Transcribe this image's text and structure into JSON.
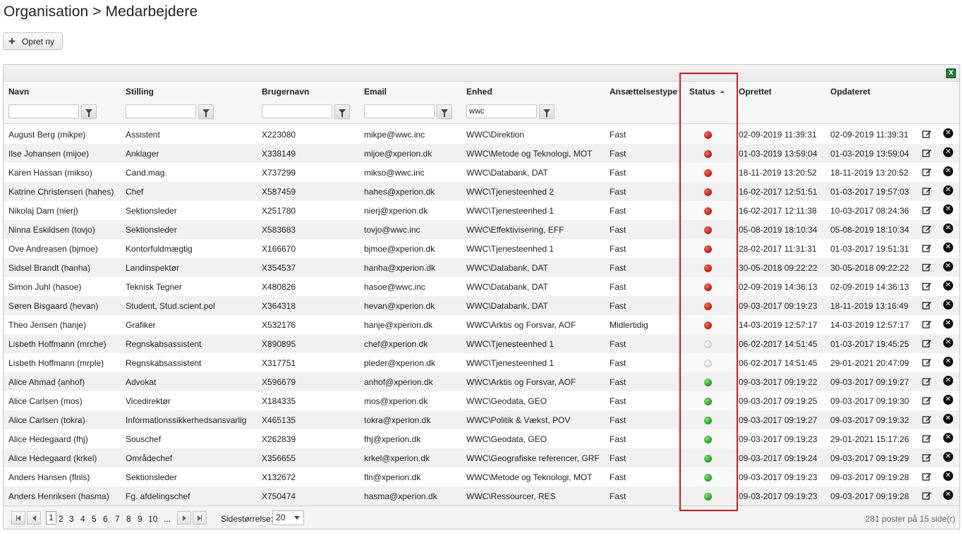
{
  "page": {
    "title": "Organisation > Medarbejdere"
  },
  "toolbar": {
    "create_label": "Opret ny",
    "create_icon": "plus-icon",
    "excel_icon": "excel-export-icon",
    "excel_text": "X"
  },
  "columns": {
    "name": "Navn",
    "position": "Stilling",
    "username": "Brugernavn",
    "email": "Email",
    "unit": "Enhed",
    "employment_type": "Ansættelsestype",
    "status": "Status",
    "created": "Oprettet",
    "updated": "Opdateret"
  },
  "filters": {
    "name": "",
    "position": "",
    "username": "",
    "email": "",
    "unit": "wwc"
  },
  "status_colors": {
    "active": "#1f9b1a",
    "inactive": "#c3170b",
    "unknown": "#d6d6d6"
  },
  "rows": [
    {
      "name": "August Berg (mikpe)",
      "position": "Assistent",
      "username": "X223080",
      "email": "mikpe@wwc.inc",
      "unit": "WWC\\Direktion",
      "type": "Fast",
      "status": "red",
      "created": "02-09-2019 11:39:31",
      "updated": "02-09-2019 11:39:31"
    },
    {
      "name": "Ilse Johansen (mijoe)",
      "position": "Anklager",
      "username": "X338149",
      "email": "mijoe@xperion.dk",
      "unit": "WWC\\Metode og Teknologi, MOT",
      "type": "Fast",
      "status": "red",
      "created": "01-03-2019 13:59:04",
      "updated": "01-03-2019 13:59:04"
    },
    {
      "name": "Karen Hassan (mikso)",
      "position": "Cand.mag.",
      "username": "X737299",
      "email": "mikso@wwc.inc",
      "unit": "WWC\\Databank, DAT",
      "type": "Fast",
      "status": "red",
      "created": "18-11-2019 13:20:52",
      "updated": "18-11-2019 13:20:52"
    },
    {
      "name": "Katrine Christensen (hahes)",
      "position": "Chef",
      "username": "X587459",
      "email": "hahes@xperion.dk",
      "unit": "WWC\\Tjenesteenhed 2",
      "type": "Fast",
      "status": "red",
      "created": "16-02-2017 12:51:51",
      "updated": "01-03-2017 19:57:03"
    },
    {
      "name": "Nikolaj Dam (nierj)",
      "position": "Sektionsleder",
      "username": "X251780",
      "email": "nierj@xperion.dk",
      "unit": "WWC\\Tjenesteenhed 1",
      "type": "Fast",
      "status": "red",
      "created": "16-02-2017 12:11:38",
      "updated": "10-03-2017 08:24:36"
    },
    {
      "name": "Ninna Eskildsen (tovjo)",
      "position": "Sektionsleder",
      "username": "X583683",
      "email": "tovjo@wwc.inc",
      "unit": "WWC\\Effektivisering, EFF",
      "type": "Fast",
      "status": "red",
      "created": "05-08-2019 18:10:34",
      "updated": "05-08-2019 18:10:34"
    },
    {
      "name": "Ove Andreasen (bjmoe)",
      "position": "Kontorfuldmægtig",
      "username": "X166670",
      "email": "bjmoe@xperion.dk",
      "unit": "WWC\\Tjenesteenhed 1",
      "type": "Fast",
      "status": "red",
      "created": "28-02-2017 11:31:31",
      "updated": "01-03-2017 19:51:31"
    },
    {
      "name": "Sidsel Brandt (hanha)",
      "position": "Landinspektør",
      "username": "X354537",
      "email": "hanha@xperion.dk",
      "unit": "WWC\\Databank, DAT",
      "type": "Fast",
      "status": "red",
      "created": "30-05-2018 09:22:22",
      "updated": "30-05-2018 09:22:22"
    },
    {
      "name": "Simon Juhl (hasoe)",
      "position": "Teknisk Tegner",
      "username": "X480826",
      "email": "hasoe@wwc.inc",
      "unit": "WWC\\Databank, DAT",
      "type": "Fast",
      "status": "red",
      "created": "02-09-2019 14:36:13",
      "updated": "02-09-2019 14:36:13"
    },
    {
      "name": "Søren Bisgaard (hevan)",
      "position": "Student, Stud.scient.pol",
      "username": "X364318",
      "email": "hevan@xperion.dk",
      "unit": "WWC\\Databank, DAT",
      "type": "Fast",
      "status": "red",
      "created": "09-03-2017 09:19:23",
      "updated": "18-11-2019 13:16:49"
    },
    {
      "name": "Theo Jensen (hanje)",
      "position": "Grafiker",
      "username": "X532176",
      "email": "hanje@xperion.dk",
      "unit": "WWC\\Arktis og Forsvar, AOF",
      "type": "Midlertidig",
      "status": "red",
      "created": "14-03-2019 12:57:17",
      "updated": "14-03-2019 12:57:17"
    },
    {
      "name": "Lisbeth Hoffmann (mrche)",
      "position": "Regnskabsassistent",
      "username": "X890895",
      "email": "chef@xperion.dk",
      "unit": "WWC\\Tjenesteenhed 1",
      "type": "Fast",
      "status": "grey",
      "created": "06-02-2017 14:51:45",
      "updated": "01-03-2017 19:45:25"
    },
    {
      "name": "Lisbeth Hoffmann (mrple)",
      "position": "Regnskabsassistent",
      "username": "X317751",
      "email": "pleder@xperion.dk",
      "unit": "WWC\\Tjenesteenhed 1",
      "type": "Fast",
      "status": "grey",
      "created": "06-02-2017 14:51:45",
      "updated": "29-01-2021 20:47:09"
    },
    {
      "name": "Alice Ahmad (anhof)",
      "position": "Advokat",
      "username": "X596679",
      "email": "anhof@xperion.dk",
      "unit": "WWC\\Arktis og Forsvar, AOF",
      "type": "Fast",
      "status": "green",
      "created": "09-03-2017 09:19:22",
      "updated": "09-03-2017 09:19:27"
    },
    {
      "name": "Alice Carlsen (mos)",
      "position": "Vicedirektør",
      "username": "X184335",
      "email": "mos@xperion.dk",
      "unit": "WWC\\Geodata, GEO",
      "type": "Fast",
      "status": "green",
      "created": "09-03-2017 09:19:25",
      "updated": "09-03-2017 09:19:30"
    },
    {
      "name": "Alice Carlsen (tokra)",
      "position": "Informationssikkerhedsansvarlig",
      "username": "X465135",
      "email": "tokra@xperion.dk",
      "unit": "WWC\\Politik & Vækst, POV",
      "type": "Fast",
      "status": "green",
      "created": "09-03-2017 09:19:27",
      "updated": "09-03-2017 09:19:32"
    },
    {
      "name": "Alice Hedegaard (fhj)",
      "position": "Souschef",
      "username": "X262839",
      "email": "fhj@xperion.dk",
      "unit": "WWC\\Geodata, GEO",
      "type": "Fast",
      "status": "green",
      "created": "09-03-2017 09:19:23",
      "updated": "29-01-2021 15:17:26"
    },
    {
      "name": "Alice Hedegaard (krkel)",
      "position": "Områdechef",
      "username": "X356655",
      "email": "krkel@xperion.dk",
      "unit": "WWC\\Geografiske referencer, GRF",
      "type": "Fast",
      "status": "green",
      "created": "09-03-2017 09:19:24",
      "updated": "09-03-2017 09:19:29"
    },
    {
      "name": "Anders Hansen (flnis)",
      "position": "Sektionsleder",
      "username": "X132672",
      "email": "fln@xperion.dk",
      "unit": "WWC\\Metode og Teknologi, MOT",
      "type": "Fast",
      "status": "green",
      "created": "09-03-2017 09:19:23",
      "updated": "09-03-2017 09:19:28"
    },
    {
      "name": "Anders Henriksen (hasma)",
      "position": "Fg. afdelingschef",
      "username": "X750474",
      "email": "hasma@xperion.dk",
      "unit": "WWC\\Ressourcer, RES",
      "type": "Fast",
      "status": "green",
      "created": "09-03-2017 09:19:23",
      "updated": "09-03-2017 09:19:28"
    }
  ],
  "row_icons": {
    "edit": "edit-icon",
    "delete": "delete-icon",
    "delete_glyph": "✕"
  },
  "pager": {
    "pages": [
      "1",
      "2",
      "3",
      "4",
      "5",
      "6",
      "7",
      "8",
      "9",
      "10",
      "..."
    ],
    "current_page": "1",
    "size_label": "Sidestørrelse:",
    "size_value": "20",
    "info": "281 poster på 15 side(r)"
  }
}
